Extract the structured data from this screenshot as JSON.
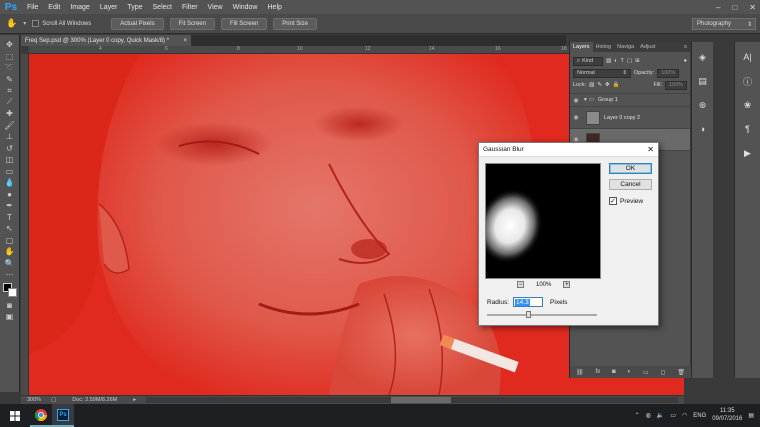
{
  "menu": [
    "File",
    "Edit",
    "Image",
    "Layer",
    "Type",
    "Select",
    "Filter",
    "View",
    "Window",
    "Help"
  ],
  "app_logo": "Ps",
  "window_controls": [
    "–",
    "□",
    "✕"
  ],
  "options_bar": {
    "scroll_all_label": "Scroll All Windows",
    "buttons": [
      "Actual Pixels",
      "Fit Screen",
      "Fill Screen",
      "Print Size"
    ],
    "workspace": "Photography"
  },
  "document": {
    "tab_title": "Freq Sep.psd @ 300% (Layer 0 copy, Quick Mask/8) *",
    "ruler_ticks": [
      "4",
      "6",
      "8",
      "10",
      "12",
      "14",
      "16",
      "18"
    ],
    "zoom": "300%",
    "doc_size": "Doc: 2.59M/8.26M"
  },
  "layers_panel": {
    "tabs": [
      "Layers",
      "Histog",
      "Naviga",
      "Adjust"
    ],
    "kind_label": "Kind",
    "blend_mode": "Normal",
    "opacity_label": "Opacity:",
    "opacity_value": "100%",
    "lock_label": "Lock:",
    "fill_label": "Fill:",
    "fill_value": "100%",
    "layers": [
      {
        "name": "Group 1",
        "type": "group"
      },
      {
        "name": "Layer 0 copy 2",
        "type": "layer"
      },
      {
        "name": "",
        "type": "layer-selected"
      }
    ]
  },
  "dialog": {
    "title": "Gaussian Blur",
    "ok_label": "OK",
    "cancel_label": "Cancel",
    "preview_label": "Preview",
    "preview_checked": true,
    "zoom_value": "100%",
    "radius_label": "Radius:",
    "radius_value": "14.3",
    "radius_unit": "Pixels",
    "slider_fraction": 0.38
  },
  "taskbar": {
    "language": "ENG",
    "time": "11:35",
    "date": "09/07/2016"
  },
  "colors": {
    "quickmask_red": "#e02a1f",
    "panel": "#535353",
    "ps_blue": "#31a8ff"
  }
}
